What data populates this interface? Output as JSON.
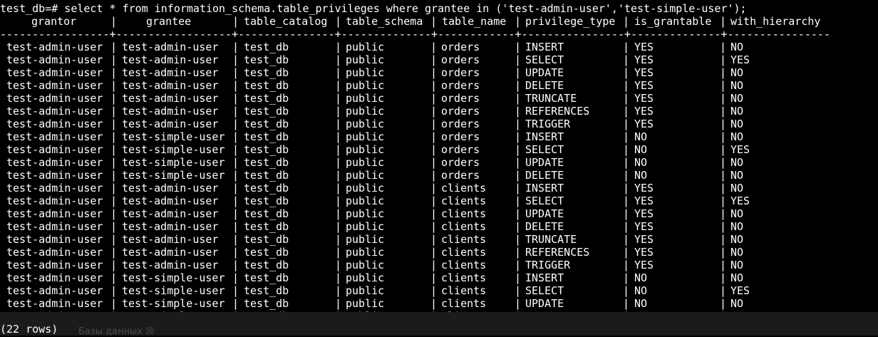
{
  "terminal": {
    "command_line": "test_db=# select * from information_schema.table_privileges where grantee in ('test-admin-user','test-simple-user');",
    "headers": [
      "grantor",
      "grantee",
      "table_catalog",
      "table_schema",
      "table_name",
      "privilege_type",
      "is_grantable",
      "with_hierarchy"
    ],
    "separator": "-----------------+------------------+---------------+--------------+------------+----------------+--------------+----------------",
    "rows": [
      [
        "test-admin-user",
        "test-admin-user",
        "test_db",
        "public",
        "orders",
        "INSERT",
        "YES",
        "NO"
      ],
      [
        "test-admin-user",
        "test-admin-user",
        "test_db",
        "public",
        "orders",
        "SELECT",
        "YES",
        "YES"
      ],
      [
        "test-admin-user",
        "test-admin-user",
        "test_db",
        "public",
        "orders",
        "UPDATE",
        "YES",
        "NO"
      ],
      [
        "test-admin-user",
        "test-admin-user",
        "test_db",
        "public",
        "orders",
        "DELETE",
        "YES",
        "NO"
      ],
      [
        "test-admin-user",
        "test-admin-user",
        "test_db",
        "public",
        "orders",
        "TRUNCATE",
        "YES",
        "NO"
      ],
      [
        "test-admin-user",
        "test-admin-user",
        "test_db",
        "public",
        "orders",
        "REFERENCES",
        "YES",
        "NO"
      ],
      [
        "test-admin-user",
        "test-admin-user",
        "test_db",
        "public",
        "orders",
        "TRIGGER",
        "YES",
        "NO"
      ],
      [
        "test-admin-user",
        "test-simple-user",
        "test_db",
        "public",
        "orders",
        "INSERT",
        "NO",
        "NO"
      ],
      [
        "test-admin-user",
        "test-simple-user",
        "test_db",
        "public",
        "orders",
        "SELECT",
        "NO",
        "YES"
      ],
      [
        "test-admin-user",
        "test-simple-user",
        "test_db",
        "public",
        "orders",
        "UPDATE",
        "NO",
        "NO"
      ],
      [
        "test-admin-user",
        "test-simple-user",
        "test_db",
        "public",
        "orders",
        "DELETE",
        "NO",
        "NO"
      ],
      [
        "test-admin-user",
        "test-admin-user",
        "test_db",
        "public",
        "clients",
        "INSERT",
        "YES",
        "NO"
      ],
      [
        "test-admin-user",
        "test-admin-user",
        "test_db",
        "public",
        "clients",
        "SELECT",
        "YES",
        "YES"
      ],
      [
        "test-admin-user",
        "test-admin-user",
        "test_db",
        "public",
        "clients",
        "UPDATE",
        "YES",
        "NO"
      ],
      [
        "test-admin-user",
        "test-admin-user",
        "test_db",
        "public",
        "clients",
        "DELETE",
        "YES",
        "NO"
      ],
      [
        "test-admin-user",
        "test-admin-user",
        "test_db",
        "public",
        "clients",
        "TRUNCATE",
        "YES",
        "NO"
      ],
      [
        "test-admin-user",
        "test-admin-user",
        "test_db",
        "public",
        "clients",
        "REFERENCES",
        "YES",
        "NO"
      ],
      [
        "test-admin-user",
        "test-admin-user",
        "test_db",
        "public",
        "clients",
        "TRIGGER",
        "YES",
        "NO"
      ],
      [
        "test-admin-user",
        "test-simple-user",
        "test_db",
        "public",
        "clients",
        "INSERT",
        "NO",
        "NO"
      ],
      [
        "test-admin-user",
        "test-simple-user",
        "test_db",
        "public",
        "clients",
        "SELECT",
        "NO",
        "YES"
      ],
      [
        "test-admin-user",
        "test-simple-user",
        "test_db",
        "public",
        "clients",
        "UPDATE",
        "NO",
        "NO"
      ],
      [
        "test-admin-user",
        "test-simple-user",
        "test_db",
        "public",
        "clients",
        "DELETE",
        "NO",
        "NO"
      ]
    ],
    "footer": "(22 rows)"
  },
  "background_window": {
    "tab_label": "Базы данных ☒"
  },
  "colors": {
    "background": "#000000",
    "text": "#ffffff",
    "ghost_text": "#4a4a4a",
    "bottom_bar": "#1b1b1b"
  }
}
